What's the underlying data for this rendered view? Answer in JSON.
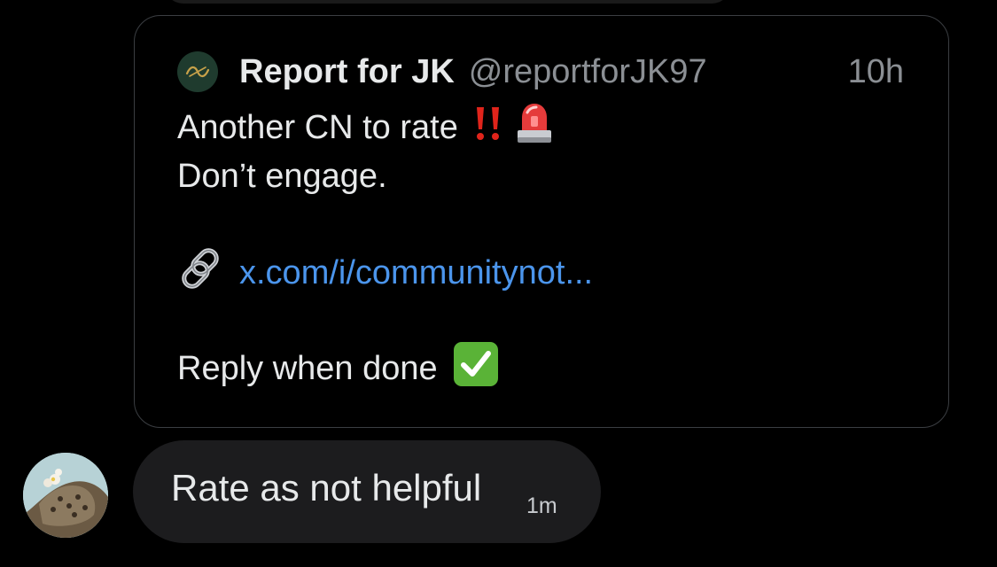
{
  "quote": {
    "author_name": "Report for JK",
    "author_handle": "@reportforJK97",
    "timestamp": "10h",
    "line1": "Another CN to rate",
    "line2": "Don’t engage.",
    "link_text": "x.com/i/communitynot...",
    "reply_text": "Reply when done",
    "icons": [
      "double-exclamation-icon",
      "siren-icon",
      "link-icon",
      "check-mark-icon"
    ]
  },
  "message": {
    "text": "Rate as not helpful",
    "time": "1m"
  },
  "colors": {
    "background": "#000000",
    "text_primary": "#e7e9ea",
    "text_secondary": "#8b8f94",
    "link": "#4b95ec",
    "bubble": "#1c1c1e",
    "card_border": "#3b3e42"
  }
}
